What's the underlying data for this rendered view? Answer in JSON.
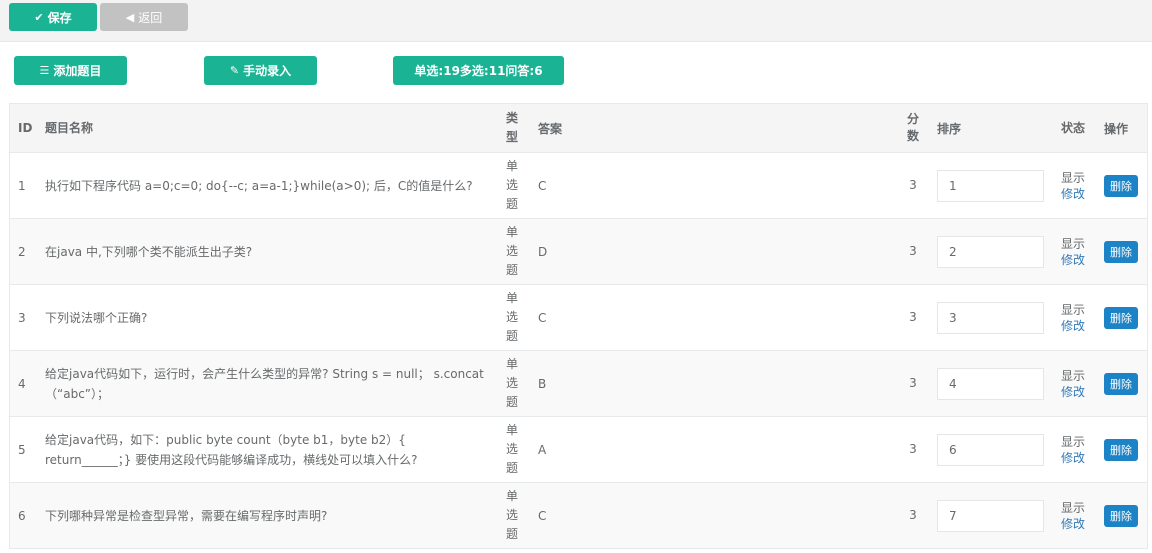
{
  "toolbar": {
    "save_label": "保存",
    "back_label": "返回"
  },
  "actions": {
    "add_label": "添加题目",
    "manual_label": "手动录入",
    "stats_label": "单选:19多选:11问答:6"
  },
  "table": {
    "headers": {
      "id": "ID",
      "name": "题目名称",
      "type": "类型",
      "answer": "答案",
      "score": "分数",
      "sort": "排序",
      "status": "状态",
      "op": "操作"
    },
    "rows": [
      {
        "id": "1",
        "name": "执行如下程序代码 a=0;c=0; do{--c; a=a-1;}while(a>0); 后，C的值是什么?",
        "type": "单选题",
        "answer": "C",
        "score": "3",
        "sort": "1",
        "status": "显示",
        "edit": "修改",
        "delete": "删除"
      },
      {
        "id": "2",
        "name": "在java 中,下列哪个类不能派生出子类?",
        "type": "单选题",
        "answer": "D",
        "score": "3",
        "sort": "2",
        "status": "显示",
        "edit": "修改",
        "delete": "删除"
      },
      {
        "id": "3",
        "name": "下列说法哪个正确?",
        "type": "单选题",
        "answer": "C",
        "score": "3",
        "sort": "3",
        "status": "显示",
        "edit": "修改",
        "delete": "删除"
      },
      {
        "id": "4",
        "name": "给定java代码如下，运行时，会产生什么类型的异常? String s = null； s.concat（“abc”）；",
        "type": "单选题",
        "answer": "B",
        "score": "3",
        "sort": "4",
        "status": "显示",
        "edit": "修改",
        "delete": "删除"
      },
      {
        "id": "5",
        "name": "给定java代码，如下：public byte count（byte b1，byte b2）{ return______；} 要使用这段代码能够编译成功，横线处可以填入什么?",
        "type": "单选题",
        "answer": "A",
        "score": "3",
        "sort": "6",
        "status": "显示",
        "edit": "修改",
        "delete": "删除"
      },
      {
        "id": "6",
        "name": "下列哪种异常是检查型异常，需要在编写程序时声明?",
        "type": "单选题",
        "answer": "C",
        "score": "3",
        "sort": "7",
        "status": "显示",
        "edit": "修改",
        "delete": "删除"
      }
    ]
  }
}
